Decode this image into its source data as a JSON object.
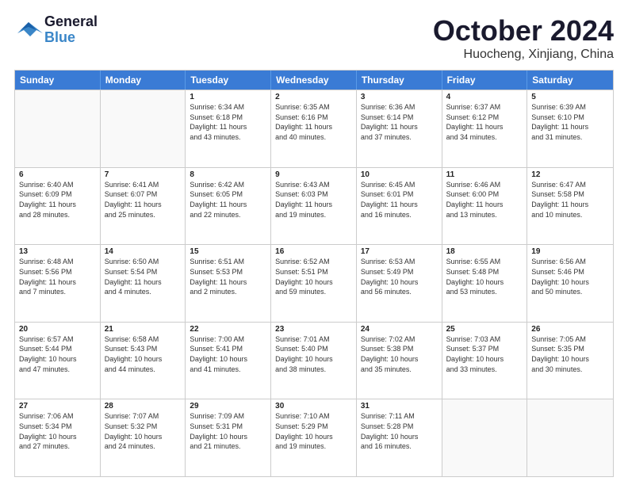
{
  "header": {
    "logo_line1": "General",
    "logo_line2": "Blue",
    "month": "October 2024",
    "location": "Huocheng, Xinjiang, China"
  },
  "days_of_week": [
    "Sunday",
    "Monday",
    "Tuesday",
    "Wednesday",
    "Thursday",
    "Friday",
    "Saturday"
  ],
  "rows": [
    [
      {
        "day": "",
        "empty": true
      },
      {
        "day": "",
        "empty": true
      },
      {
        "day": "1",
        "lines": [
          "Sunrise: 6:34 AM",
          "Sunset: 6:18 PM",
          "Daylight: 11 hours",
          "and 43 minutes."
        ]
      },
      {
        "day": "2",
        "lines": [
          "Sunrise: 6:35 AM",
          "Sunset: 6:16 PM",
          "Daylight: 11 hours",
          "and 40 minutes."
        ]
      },
      {
        "day": "3",
        "lines": [
          "Sunrise: 6:36 AM",
          "Sunset: 6:14 PM",
          "Daylight: 11 hours",
          "and 37 minutes."
        ]
      },
      {
        "day": "4",
        "lines": [
          "Sunrise: 6:37 AM",
          "Sunset: 6:12 PM",
          "Daylight: 11 hours",
          "and 34 minutes."
        ]
      },
      {
        "day": "5",
        "lines": [
          "Sunrise: 6:39 AM",
          "Sunset: 6:10 PM",
          "Daylight: 11 hours",
          "and 31 minutes."
        ]
      }
    ],
    [
      {
        "day": "6",
        "lines": [
          "Sunrise: 6:40 AM",
          "Sunset: 6:09 PM",
          "Daylight: 11 hours",
          "and 28 minutes."
        ]
      },
      {
        "day": "7",
        "lines": [
          "Sunrise: 6:41 AM",
          "Sunset: 6:07 PM",
          "Daylight: 11 hours",
          "and 25 minutes."
        ]
      },
      {
        "day": "8",
        "lines": [
          "Sunrise: 6:42 AM",
          "Sunset: 6:05 PM",
          "Daylight: 11 hours",
          "and 22 minutes."
        ]
      },
      {
        "day": "9",
        "lines": [
          "Sunrise: 6:43 AM",
          "Sunset: 6:03 PM",
          "Daylight: 11 hours",
          "and 19 minutes."
        ]
      },
      {
        "day": "10",
        "lines": [
          "Sunrise: 6:45 AM",
          "Sunset: 6:01 PM",
          "Daylight: 11 hours",
          "and 16 minutes."
        ]
      },
      {
        "day": "11",
        "lines": [
          "Sunrise: 6:46 AM",
          "Sunset: 6:00 PM",
          "Daylight: 11 hours",
          "and 13 minutes."
        ]
      },
      {
        "day": "12",
        "lines": [
          "Sunrise: 6:47 AM",
          "Sunset: 5:58 PM",
          "Daylight: 11 hours",
          "and 10 minutes."
        ]
      }
    ],
    [
      {
        "day": "13",
        "lines": [
          "Sunrise: 6:48 AM",
          "Sunset: 5:56 PM",
          "Daylight: 11 hours",
          "and 7 minutes."
        ]
      },
      {
        "day": "14",
        "lines": [
          "Sunrise: 6:50 AM",
          "Sunset: 5:54 PM",
          "Daylight: 11 hours",
          "and 4 minutes."
        ]
      },
      {
        "day": "15",
        "lines": [
          "Sunrise: 6:51 AM",
          "Sunset: 5:53 PM",
          "Daylight: 11 hours",
          "and 2 minutes."
        ]
      },
      {
        "day": "16",
        "lines": [
          "Sunrise: 6:52 AM",
          "Sunset: 5:51 PM",
          "Daylight: 10 hours",
          "and 59 minutes."
        ]
      },
      {
        "day": "17",
        "lines": [
          "Sunrise: 6:53 AM",
          "Sunset: 5:49 PM",
          "Daylight: 10 hours",
          "and 56 minutes."
        ]
      },
      {
        "day": "18",
        "lines": [
          "Sunrise: 6:55 AM",
          "Sunset: 5:48 PM",
          "Daylight: 10 hours",
          "and 53 minutes."
        ]
      },
      {
        "day": "19",
        "lines": [
          "Sunrise: 6:56 AM",
          "Sunset: 5:46 PM",
          "Daylight: 10 hours",
          "and 50 minutes."
        ]
      }
    ],
    [
      {
        "day": "20",
        "lines": [
          "Sunrise: 6:57 AM",
          "Sunset: 5:44 PM",
          "Daylight: 10 hours",
          "and 47 minutes."
        ]
      },
      {
        "day": "21",
        "lines": [
          "Sunrise: 6:58 AM",
          "Sunset: 5:43 PM",
          "Daylight: 10 hours",
          "and 44 minutes."
        ]
      },
      {
        "day": "22",
        "lines": [
          "Sunrise: 7:00 AM",
          "Sunset: 5:41 PM",
          "Daylight: 10 hours",
          "and 41 minutes."
        ]
      },
      {
        "day": "23",
        "lines": [
          "Sunrise: 7:01 AM",
          "Sunset: 5:40 PM",
          "Daylight: 10 hours",
          "and 38 minutes."
        ]
      },
      {
        "day": "24",
        "lines": [
          "Sunrise: 7:02 AM",
          "Sunset: 5:38 PM",
          "Daylight: 10 hours",
          "and 35 minutes."
        ]
      },
      {
        "day": "25",
        "lines": [
          "Sunrise: 7:03 AM",
          "Sunset: 5:37 PM",
          "Daylight: 10 hours",
          "and 33 minutes."
        ]
      },
      {
        "day": "26",
        "lines": [
          "Sunrise: 7:05 AM",
          "Sunset: 5:35 PM",
          "Daylight: 10 hours",
          "and 30 minutes."
        ]
      }
    ],
    [
      {
        "day": "27",
        "lines": [
          "Sunrise: 7:06 AM",
          "Sunset: 5:34 PM",
          "Daylight: 10 hours",
          "and 27 minutes."
        ]
      },
      {
        "day": "28",
        "lines": [
          "Sunrise: 7:07 AM",
          "Sunset: 5:32 PM",
          "Daylight: 10 hours",
          "and 24 minutes."
        ]
      },
      {
        "day": "29",
        "lines": [
          "Sunrise: 7:09 AM",
          "Sunset: 5:31 PM",
          "Daylight: 10 hours",
          "and 21 minutes."
        ]
      },
      {
        "day": "30",
        "lines": [
          "Sunrise: 7:10 AM",
          "Sunset: 5:29 PM",
          "Daylight: 10 hours",
          "and 19 minutes."
        ]
      },
      {
        "day": "31",
        "lines": [
          "Sunrise: 7:11 AM",
          "Sunset: 5:28 PM",
          "Daylight: 10 hours",
          "and 16 minutes."
        ]
      },
      {
        "day": "",
        "empty": true
      },
      {
        "day": "",
        "empty": true
      }
    ]
  ]
}
